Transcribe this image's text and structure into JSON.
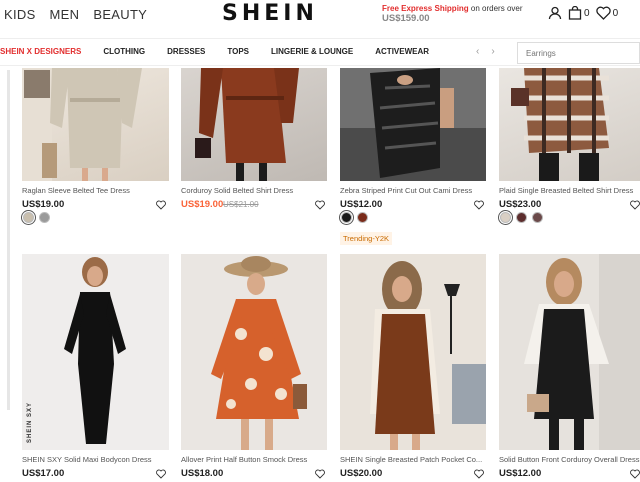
{
  "header": {
    "top_links": [
      "KIDS",
      "MEN",
      "BEAUTY"
    ],
    "logo": "SHEIN",
    "promo_highlight": "Free Express Shipping",
    "promo_rest": " on orders over",
    "promo_price": "US$159.00",
    "bag_count": "0",
    "wishlist_count": "0",
    "icons": [
      "user-icon",
      "bag-icon",
      "heart-icon"
    ]
  },
  "nav": {
    "items": [
      "SHEIN X DESIGNERS",
      "CLOTHING",
      "DRESSES",
      "TOPS",
      "LINGERIE & LOUNGE",
      "ACTIVEWEAR"
    ],
    "search_placeholder": "Earrings",
    "accent": "#e22e2e"
  },
  "products": [
    {
      "title": "Raglan Sleeve Belted Tee Dress",
      "price": "US$19.00",
      "old_price": "",
      "sale": false,
      "swatches": [
        "#c9bfae",
        "#9a9a9a"
      ],
      "tag": ""
    },
    {
      "title": "Corduroy Solid Belted Shirt Dress",
      "price": "US$19.00",
      "old_price": "US$21.00",
      "sale": true,
      "swatches": [],
      "tag": ""
    },
    {
      "title": "Zebra Striped Print Cut Out Cami Dress",
      "price": "US$12.00",
      "old_price": "",
      "sale": false,
      "swatches": [
        "#1a1a1a",
        "#7a2b1a"
      ],
      "tag": "Trending-Y2K"
    },
    {
      "title": "Plaid Single Breasted Belted Shirt Dress",
      "price": "US$23.00",
      "old_price": "",
      "sale": false,
      "swatches": [
        "#d9cfc4",
        "#5c2d2d",
        "#6b4a4a"
      ],
      "tag": ""
    },
    {
      "title": "SHEIN SXY Solid Maxi Bodycon Dress",
      "price": "US$17.00",
      "old_price": "",
      "sale": false,
      "swatches": [],
      "tag": "",
      "brand_mark": "SHEIN SXY"
    },
    {
      "title": "Allover Print Half Button Smock Dress",
      "price": "US$18.00",
      "old_price": "",
      "sale": false,
      "swatches": [],
      "tag": ""
    },
    {
      "title": "SHEIN Single Breasted Patch Pocket Co...",
      "price": "US$20.00",
      "old_price": "",
      "sale": false,
      "swatches": [],
      "tag": ""
    },
    {
      "title": "Solid Button Front Corduroy Overall Dress",
      "price": "US$12.00",
      "old_price": "",
      "sale": false,
      "swatches": [],
      "tag": ""
    }
  ],
  "colors": {
    "sale_price": "#fa6338",
    "tag_text": "#c96b00"
  }
}
